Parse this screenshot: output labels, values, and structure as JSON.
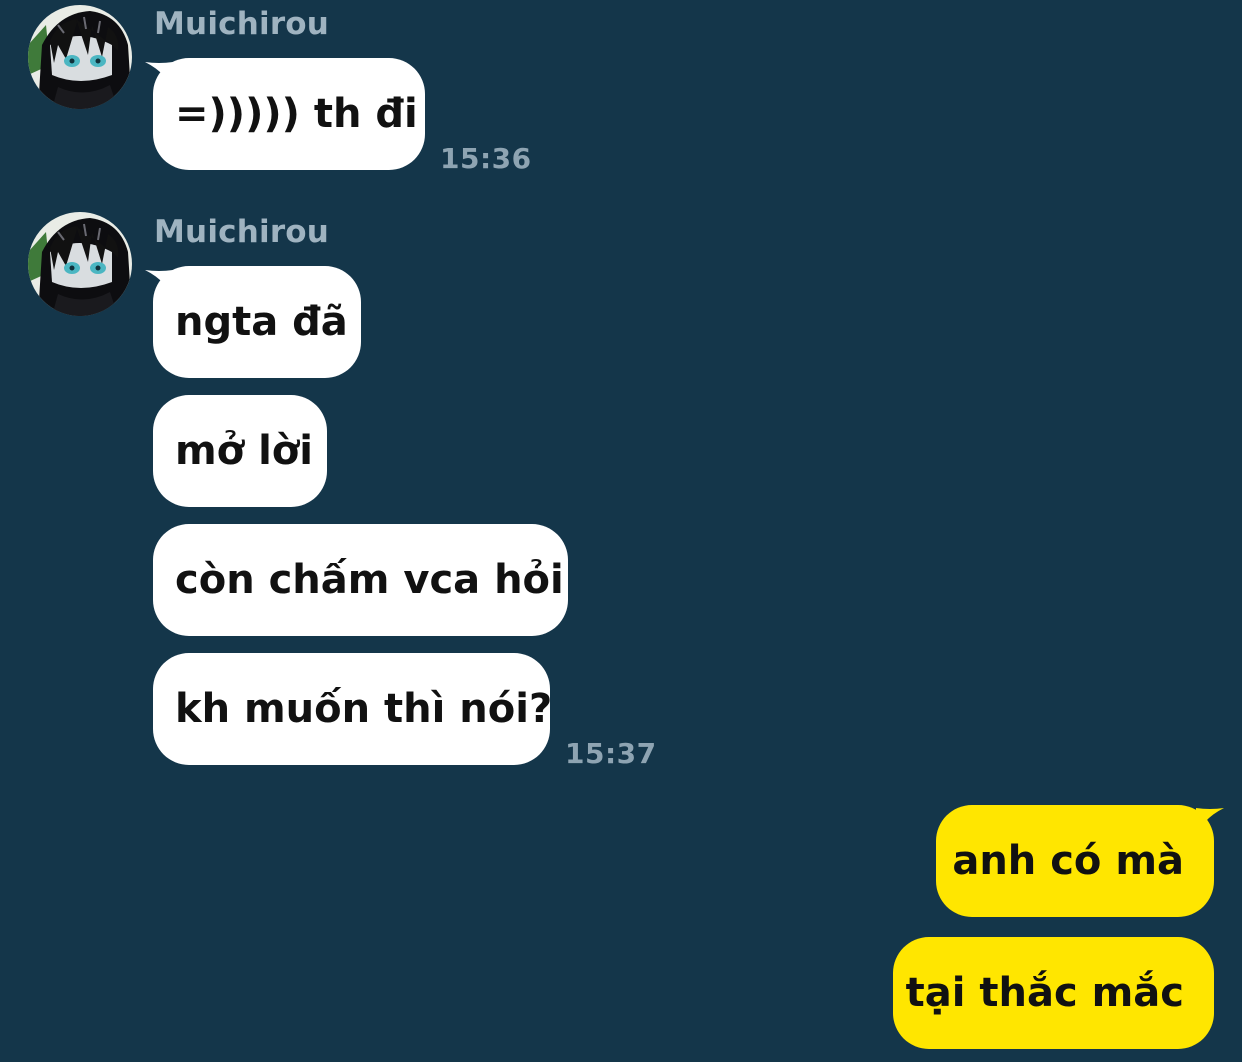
{
  "conversation": {
    "groups": [
      {
        "sender": "Muichirou",
        "messages": [
          "=))))) th đi"
        ],
        "time": "15:36"
      },
      {
        "sender": "Muichirou",
        "messages": [
          "ngta đã",
          "mở lời",
          "còn chấm vca hỏi",
          "kh muốn thì nói?"
        ],
        "time": "15:37"
      }
    ],
    "outgoing": {
      "messages": [
        "anh có mà",
        "tại thắc mắc"
      ]
    }
  },
  "icons": {
    "avatar": "anime-character-avatar"
  },
  "colors": {
    "background": "#14364a",
    "incoming_bubble": "#ffffff",
    "outgoing_bubble": "#ffe600",
    "sender_name": "#9fb3c0",
    "timestamp": "#8ea4b2"
  }
}
